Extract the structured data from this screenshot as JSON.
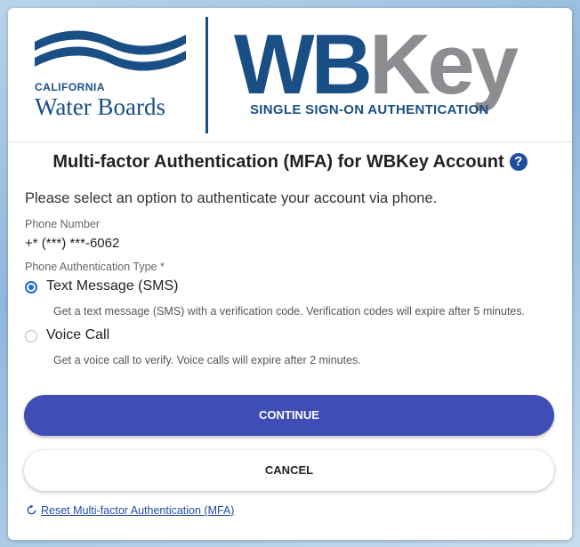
{
  "header": {
    "org_small": "CALIFORNIA",
    "org_name": "Water Boards",
    "brand_wb": "WB",
    "brand_key": "Key",
    "brand_subtitle": "SINGLE SIGN-ON AUTHENTICATION"
  },
  "page_title": "Multi-factor Authentication (MFA) for WBKey Account",
  "help_icon": "?",
  "instructions": "Please select an option to authenticate your account via phone.",
  "phone": {
    "label": "Phone Number",
    "value": "+* (***) ***-6062"
  },
  "auth_type": {
    "label": "Phone Authentication Type *",
    "options": [
      {
        "label": "Text Message (SMS)",
        "description": "Get a text message (SMS) with a verification code. Verification codes will expire after 5 minutes.",
        "selected": true
      },
      {
        "label": "Voice Call",
        "description": "Get a voice call to verify. Voice calls will expire after 2 minutes.",
        "selected": false
      }
    ]
  },
  "buttons": {
    "continue": "CONTINUE",
    "cancel": "CANCEL"
  },
  "reset_link": "Reset Multi-factor Authentication (MFA)",
  "colors": {
    "brand_blue": "#1a4f86",
    "brand_gray": "#8c8d90",
    "primary_button": "#3f4eb4",
    "radio_selected": "#1a6ad8",
    "link": "#1f4ea0"
  },
  "icons": [
    "help-icon",
    "reset-icon"
  ]
}
